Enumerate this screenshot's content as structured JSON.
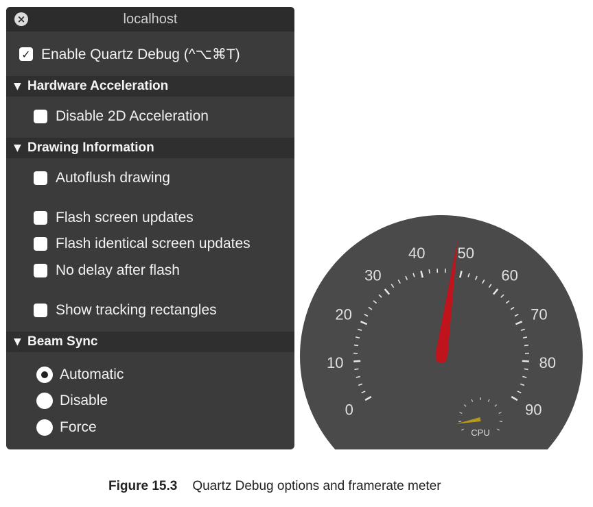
{
  "window": {
    "title": "localhost",
    "close_icon": "close-icon"
  },
  "options": {
    "enable_quartz": {
      "label": "Enable Quartz Debug (^⌥⌘T)",
      "checked": true
    },
    "hardware": {
      "header": "Hardware Acceleration",
      "disable_2d": {
        "label": "Disable 2D Acceleration",
        "checked": false
      }
    },
    "drawing": {
      "header": "Drawing Information",
      "items": [
        {
          "label": "Autoflush drawing",
          "checked": false
        },
        {
          "label": "Flash screen updates",
          "checked": false
        },
        {
          "label": "Flash identical screen updates",
          "checked": false
        },
        {
          "label": "No delay after flash",
          "checked": false
        },
        {
          "label": "Show tracking rectangles",
          "checked": false
        }
      ]
    },
    "beam_sync": {
      "header": "Beam Sync",
      "radios": [
        {
          "label": "Automatic",
          "selected": true
        },
        {
          "label": "Disable",
          "selected": false
        },
        {
          "label": "Force",
          "selected": false
        }
      ]
    }
  },
  "meter": {
    "ticks": [
      "0",
      "10",
      "20",
      "30",
      "40",
      "50",
      "60",
      "70",
      "80",
      "90"
    ],
    "max": 90,
    "value": 48,
    "needle_color": "#c0141c",
    "face_color": "#4a4a4a",
    "cpu": {
      "label": "CPU",
      "value": 0.08,
      "needle_color": "#b89a1a"
    }
  },
  "caption": {
    "figure": "Figure 15.3",
    "text": "Quartz Debug options and framerate meter"
  }
}
